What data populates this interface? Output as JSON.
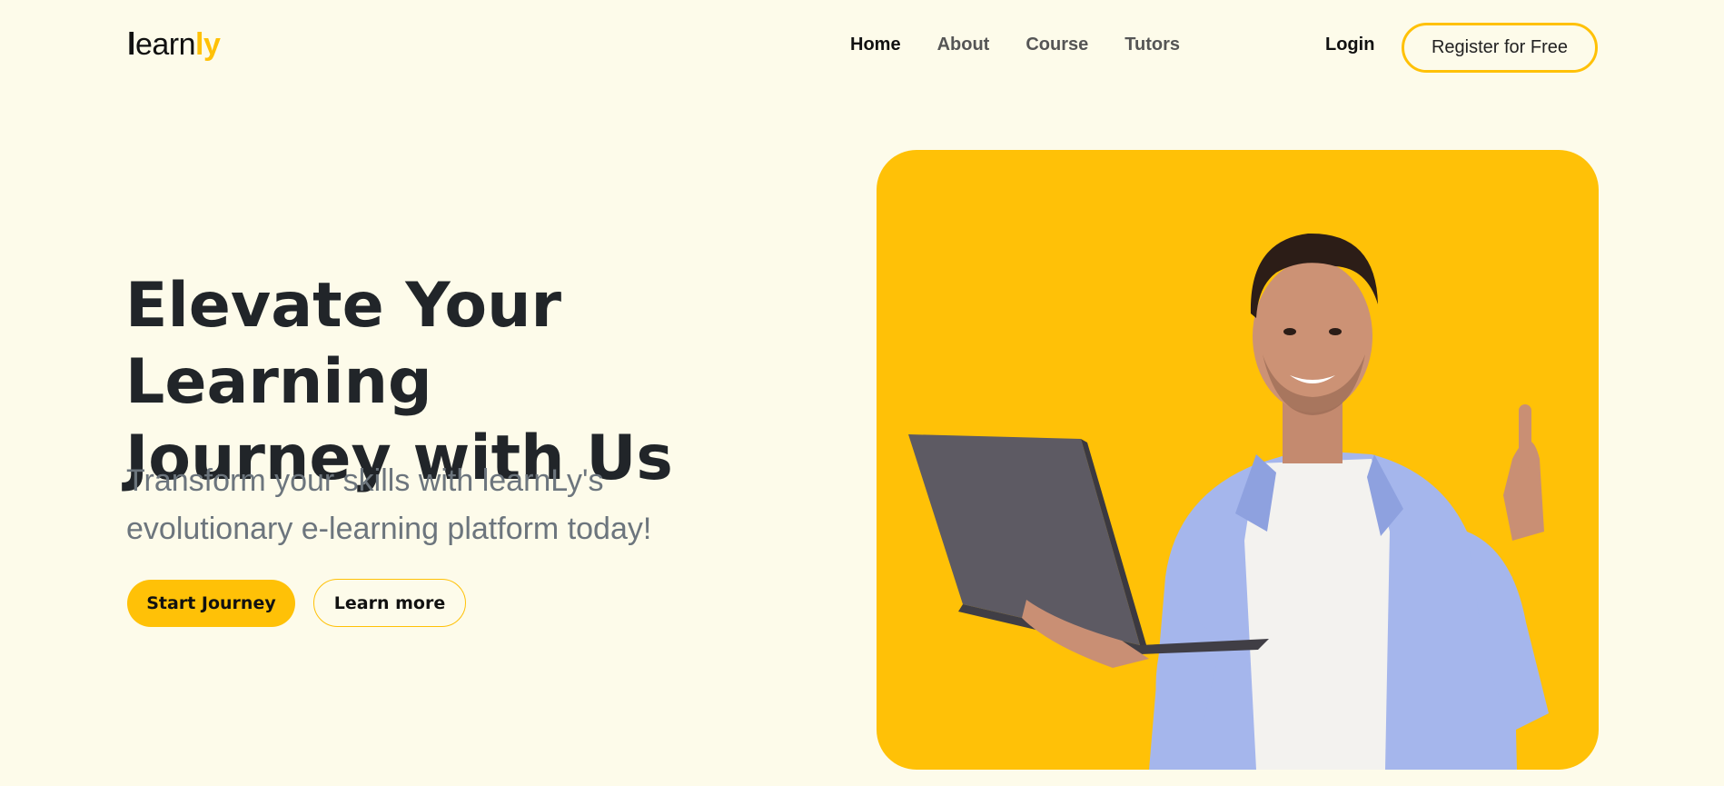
{
  "brand": {
    "logo_main": "learn",
    "logo_accent": "ly",
    "accent_color": "#ffc107"
  },
  "nav": {
    "items": [
      {
        "label": "Home",
        "active": true
      },
      {
        "label": "About",
        "active": false
      },
      {
        "label": "Course",
        "active": false
      },
      {
        "label": "Tutors",
        "active": false
      }
    ],
    "login_label": "Login",
    "register_label": "Register for Free"
  },
  "hero": {
    "title_line1": "Elevate Your Learning",
    "title_line2": "Journey with Us",
    "subtitle_line1": "Transform your skills with learnLy's",
    "subtitle_line2": "evolutionary e-learning platform today!",
    "primary_cta": "Start Journey",
    "secondary_cta": "Learn more",
    "image_subject": "smiling man holding laptop pointing up"
  },
  "colors": {
    "background": "#fdfbea",
    "accent": "#ffc107",
    "heading": "#212529",
    "muted": "#6c757d"
  }
}
